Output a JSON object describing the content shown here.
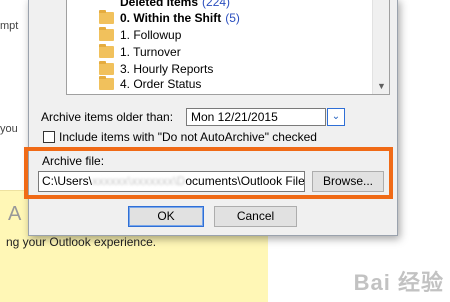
{
  "background": {
    "frag_top": "mpt",
    "frag_mid1": "you",
    "frag_mid2": "y A",
    "big_letter": "A",
    "text": "ng your Outlook experience."
  },
  "tree": {
    "items": [
      {
        "label": "Deleted Items",
        "count": "(224)",
        "bold": true
      },
      {
        "label": "0. Within the Shift",
        "count": "(5)",
        "bold": true
      },
      {
        "label": "1. Followup",
        "count": "",
        "bold": false
      },
      {
        "label": "1. Turnover",
        "count": "",
        "bold": false
      },
      {
        "label": "3. Hourly Reports",
        "count": "",
        "bold": false
      },
      {
        "label": "4. Order Status",
        "count": "",
        "bold": false
      }
    ]
  },
  "archive": {
    "older_than_label": "Archive items older than:",
    "date_value": "Mon 12/21/2015",
    "checkbox_label": "Include items with \"Do not AutoArchive\" checked",
    "file_label": "Archive file:",
    "path_start": "C:\\Users\\",
    "path_blur": "xxxxxx\\xxxxxxx\\D",
    "path_end": "ocuments\\Outlook Files",
    "browse_label": "Browse..."
  },
  "buttons": {
    "ok": "OK",
    "cancel": "Cancel"
  },
  "watermark": "Bai 经验"
}
